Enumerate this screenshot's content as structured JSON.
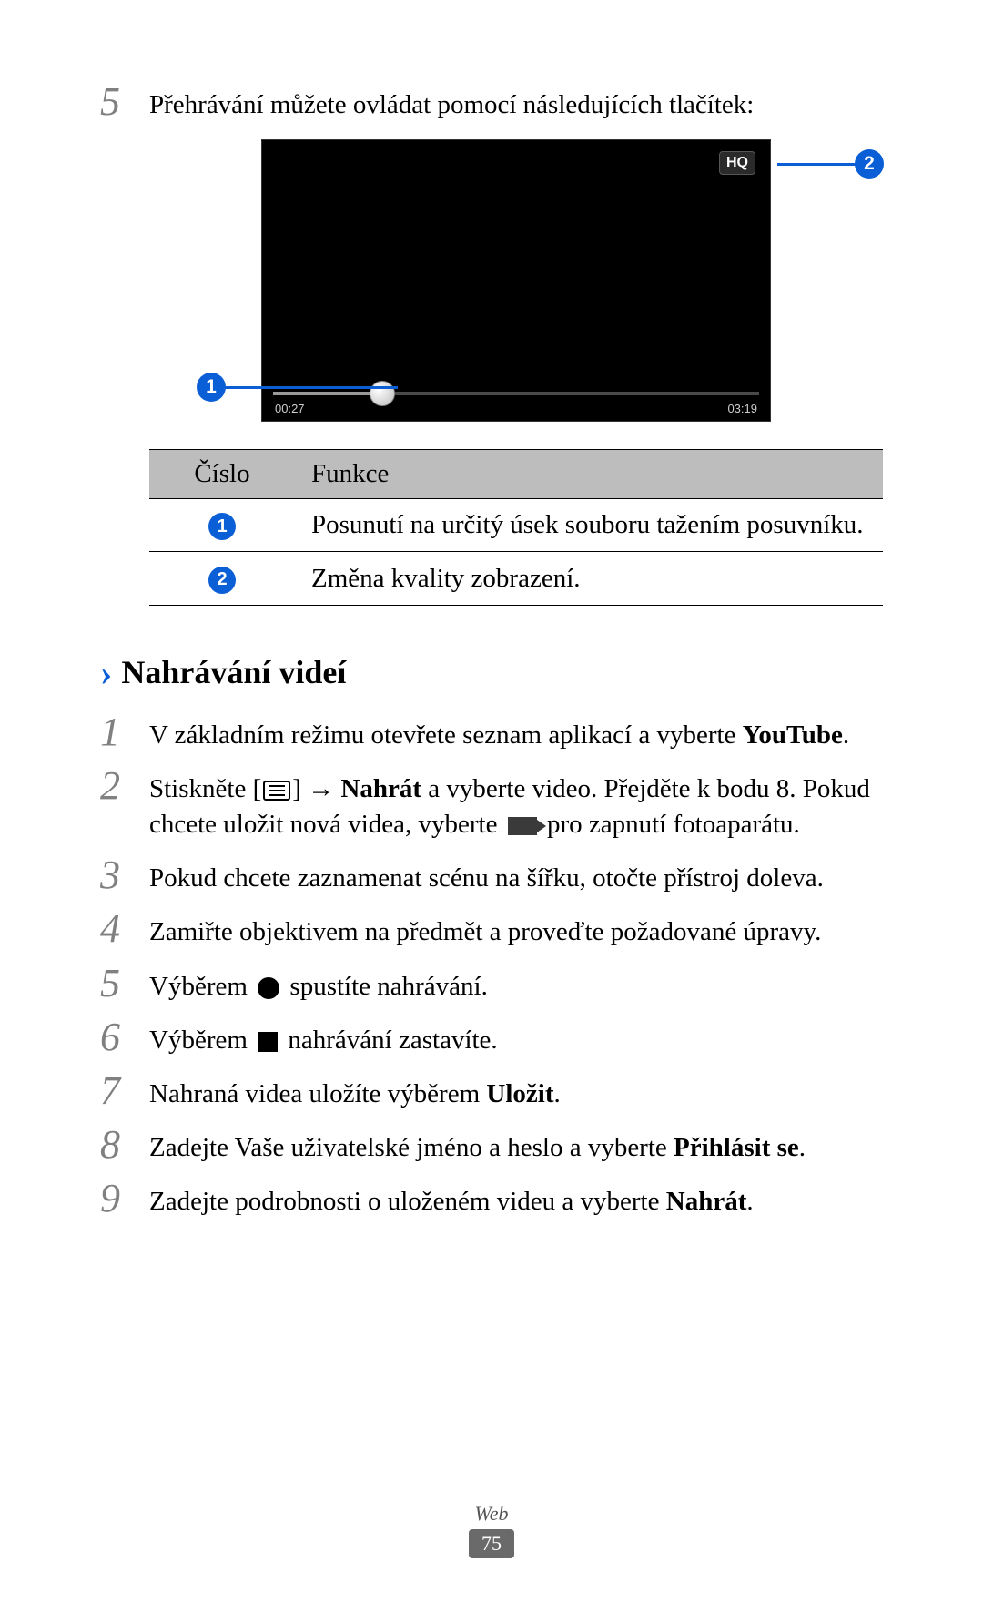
{
  "top_step": {
    "num": "5",
    "text": "Přehrávání můžete ovládat pomocí následujících tlačítek:"
  },
  "player": {
    "hq": "HQ",
    "time_left": "00:27",
    "time_right": "03:19",
    "callout1": "1",
    "callout2": "2"
  },
  "table": {
    "head_num": "Číslo",
    "head_func": "Funkce",
    "rows": [
      {
        "badge": "1",
        "desc": "Posunutí na určitý úsek souboru tažením posuvníku."
      },
      {
        "badge": "2",
        "desc": "Změna kvality zobrazení."
      }
    ]
  },
  "section": {
    "title": "Nahrávání videí"
  },
  "steps": [
    {
      "num": "1",
      "parts": [
        "V základním režimu otevřete seznam aplikací a vyberte ",
        {
          "b": "YouTube"
        },
        "."
      ]
    },
    {
      "num": "2",
      "parts": [
        "Stiskněte [",
        {
          "icon": "menu"
        },
        "] → ",
        {
          "b": "Nahrát"
        },
        " a vyberte video. Přejděte k bodu 8. Pokud chcete uložit nová videa, vyberte ",
        {
          "icon": "camera"
        },
        " pro zapnutí fotoaparátu."
      ]
    },
    {
      "num": "3",
      "parts": [
        "Pokud chcete zaznamenat scénu na šířku, otočte přístroj doleva."
      ]
    },
    {
      "num": "4",
      "parts": [
        "Zamiřte objektivem na předmět a proveďte požadované úpravy."
      ]
    },
    {
      "num": "5",
      "parts": [
        "Výběrem ",
        {
          "icon": "circle"
        },
        " spustíte nahrávání."
      ]
    },
    {
      "num": "6",
      "parts": [
        "Výběrem ",
        {
          "icon": "square"
        },
        " nahrávání zastavíte."
      ]
    },
    {
      "num": "7",
      "parts": [
        "Nahraná videa uložíte výběrem ",
        {
          "b": "Uložit"
        },
        "."
      ]
    },
    {
      "num": "8",
      "parts": [
        "Zadejte Vaše uživatelské jméno a heslo a vyberte ",
        {
          "b": "Přihlásit se"
        },
        "."
      ]
    },
    {
      "num": "9",
      "parts": [
        "Zadejte podrobnosti o uloženém videu a vyberte ",
        {
          "b": "Nahrát"
        },
        "."
      ]
    }
  ],
  "footer": {
    "label": "Web",
    "page": "75"
  }
}
